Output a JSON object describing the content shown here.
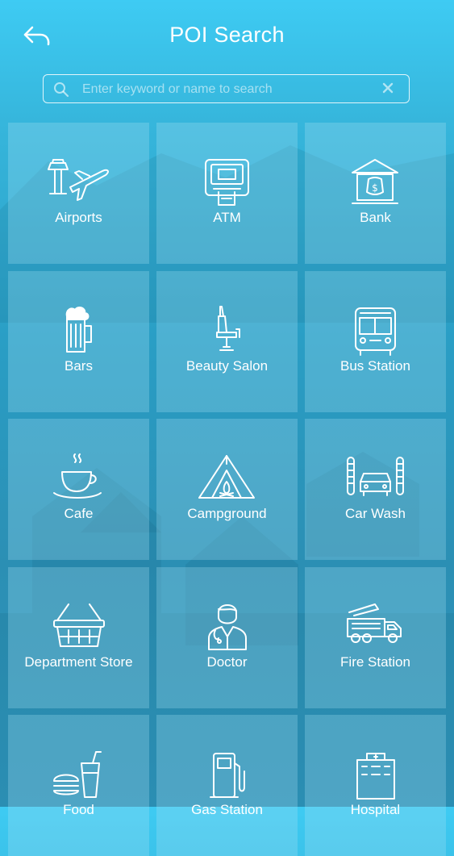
{
  "header": {
    "title": "POI Search",
    "back_icon": "back-arrow-icon"
  },
  "search": {
    "placeholder": "Enter keyword or name to search",
    "value": "",
    "search_icon": "search-icon",
    "clear_icon": "clear-icon"
  },
  "colors": {
    "background_top": "#3ecbf3",
    "background_bottom": "#2b8fb4",
    "text": "#ffffff"
  },
  "categories": [
    {
      "label": "Airports",
      "icon": "airport-icon"
    },
    {
      "label": "ATM",
      "icon": "atm-icon"
    },
    {
      "label": "Bank",
      "icon": "bank-icon"
    },
    {
      "label": "Bars",
      "icon": "beer-mug-icon"
    },
    {
      "label": "Beauty Salon",
      "icon": "salon-chair-icon"
    },
    {
      "label": "Bus Station",
      "icon": "bus-icon"
    },
    {
      "label": "Cafe",
      "icon": "coffee-cup-icon"
    },
    {
      "label": "Campground",
      "icon": "tent-icon"
    },
    {
      "label": "Car Wash",
      "icon": "car-wash-icon"
    },
    {
      "label": "Department Store",
      "icon": "shopping-basket-icon"
    },
    {
      "label": "Doctor",
      "icon": "doctor-icon"
    },
    {
      "label": "Fire Station",
      "icon": "fire-truck-icon"
    },
    {
      "label": "Food",
      "icon": "fast-food-icon"
    },
    {
      "label": "Gas Station",
      "icon": "fuel-pump-icon"
    },
    {
      "label": "Hospital",
      "icon": "hospital-icon"
    }
  ]
}
